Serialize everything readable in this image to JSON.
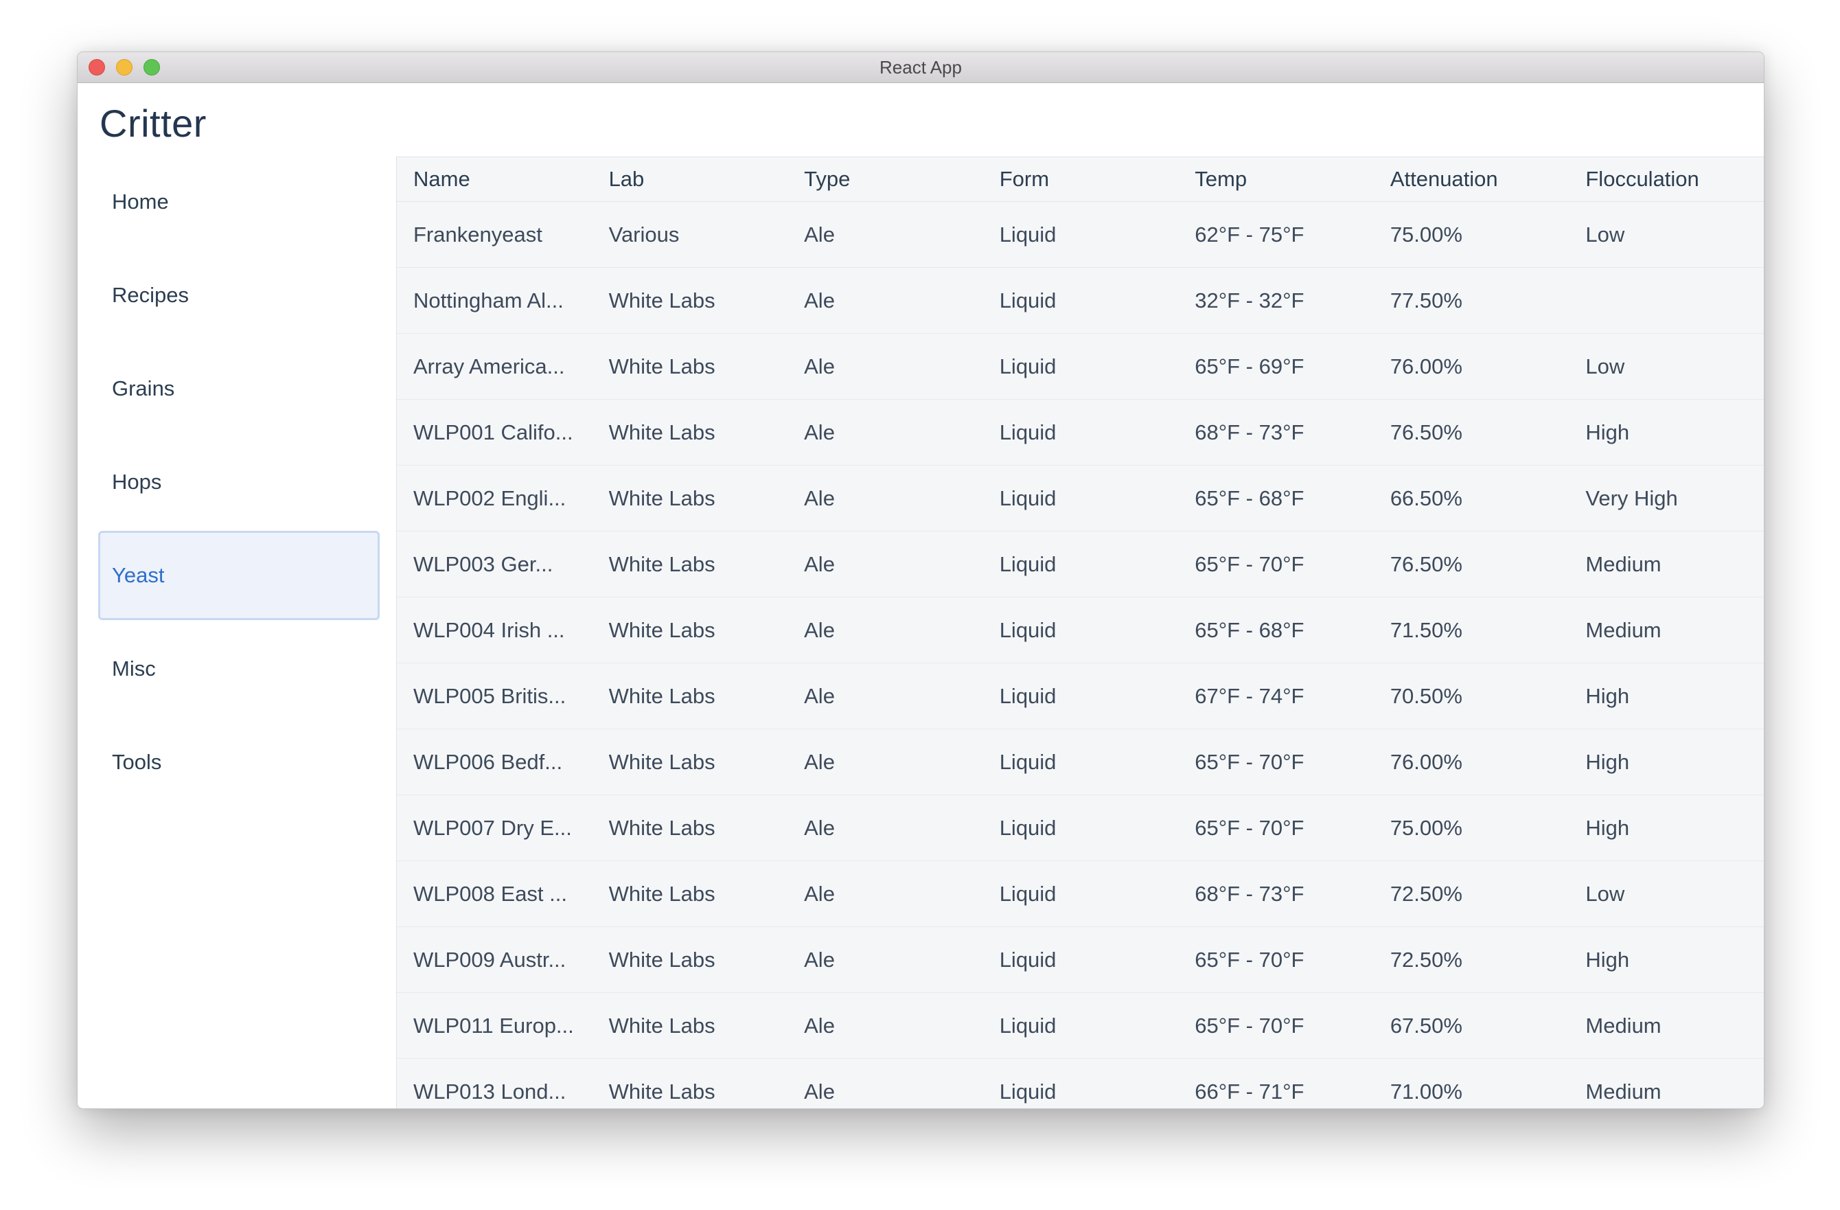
{
  "window": {
    "title": "React App"
  },
  "brand": "Critter",
  "nav": {
    "items": [
      {
        "label": "Home"
      },
      {
        "label": "Recipes"
      },
      {
        "label": "Grains"
      },
      {
        "label": "Hops"
      },
      {
        "label": "Yeast",
        "active": true
      },
      {
        "label": "Misc"
      },
      {
        "label": "Tools"
      }
    ]
  },
  "table": {
    "columns": [
      "Name",
      "Lab",
      "Type",
      "Form",
      "Temp",
      "Attenuation",
      "Flocculation"
    ],
    "rows": [
      [
        "Frankenyeast",
        "Various",
        "Ale",
        "Liquid",
        "62°F - 75°F",
        "75.00%",
        "Low"
      ],
      [
        "Nottingham Al...",
        "White Labs",
        "Ale",
        "Liquid",
        "32°F - 32°F",
        "77.50%",
        ""
      ],
      [
        "Array America...",
        "White Labs",
        "Ale",
        "Liquid",
        "65°F - 69°F",
        "76.00%",
        "Low"
      ],
      [
        "WLP001 Califo...",
        "White Labs",
        "Ale",
        "Liquid",
        "68°F - 73°F",
        "76.50%",
        "High"
      ],
      [
        "WLP002 Engli...",
        "White Labs",
        "Ale",
        "Liquid",
        "65°F - 68°F",
        "66.50%",
        "Very High"
      ],
      [
        "WLP003 Ger...",
        "White Labs",
        "Ale",
        "Liquid",
        "65°F - 70°F",
        "76.50%",
        "Medium"
      ],
      [
        "WLP004 Irish ...",
        "White Labs",
        "Ale",
        "Liquid",
        "65°F - 68°F",
        "71.50%",
        "Medium"
      ],
      [
        "WLP005 Britis...",
        "White Labs",
        "Ale",
        "Liquid",
        "67°F - 74°F",
        "70.50%",
        "High"
      ],
      [
        "WLP006 Bedf...",
        "White Labs",
        "Ale",
        "Liquid",
        "65°F - 70°F",
        "76.00%",
        "High"
      ],
      [
        "WLP007 Dry E...",
        "White Labs",
        "Ale",
        "Liquid",
        "65°F - 70°F",
        "75.00%",
        "High"
      ],
      [
        "WLP008 East ...",
        "White Labs",
        "Ale",
        "Liquid",
        "68°F - 73°F",
        "72.50%",
        "Low"
      ],
      [
        "WLP009 Austr...",
        "White Labs",
        "Ale",
        "Liquid",
        "65°F - 70°F",
        "72.50%",
        "High"
      ],
      [
        "WLP011 Europ...",
        "White Labs",
        "Ale",
        "Liquid",
        "65°F - 70°F",
        "67.50%",
        "Medium"
      ],
      [
        "WLP013 Lond...",
        "White Labs",
        "Ale",
        "Liquid",
        "66°F - 71°F",
        "71.00%",
        "Medium"
      ]
    ]
  },
  "colors": {
    "brand_text": "#24364f",
    "active_nav_bg": "#edf2fb",
    "active_nav_border": "#c8d8f1",
    "active_nav_text": "#2f6fc9",
    "table_bg": "#f5f6f8"
  }
}
